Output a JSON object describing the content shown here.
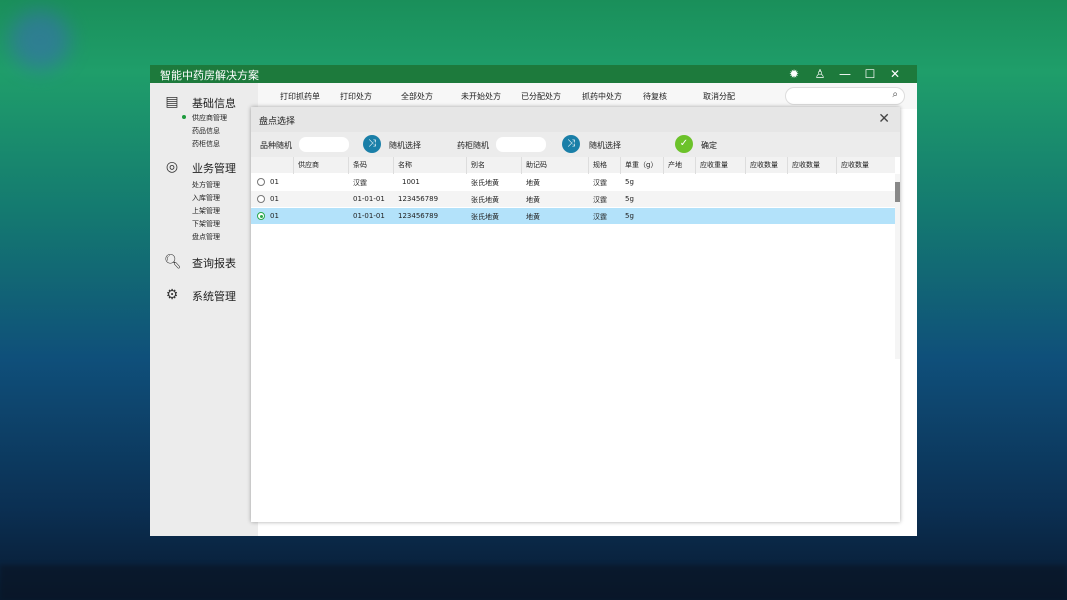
{
  "app": {
    "title": "智能中药房解决方案"
  },
  "titlebar_icons": [
    "settings-icon",
    "user-icon",
    "minimize-icon",
    "maximize-icon",
    "close-icon"
  ],
  "sidebar": {
    "sections": [
      {
        "label": "基础信息",
        "icon": "document-icon",
        "items": [
          "供应商管理",
          "药品信息",
          "药柜信息"
        ],
        "active_item": 0
      },
      {
        "label": "业务管理",
        "icon": "target-icon",
        "items": [
          "处方管理",
          "入库管理",
          "上架管理",
          "下架管理",
          "盘点管理"
        ]
      },
      {
        "label": "查询报表",
        "icon": "search-icon",
        "items": []
      },
      {
        "label": "系统管理",
        "icon": "gear-icon",
        "items": []
      }
    ]
  },
  "toolbar": {
    "buttons": [
      "打印抓药单",
      "打印处方",
      "全部处方",
      "未开始处方",
      "已分配处方",
      "抓药中处方",
      "待复核",
      "取消分配"
    ],
    "search_placeholder": ""
  },
  "dialog": {
    "title": "盘点选择",
    "variety_random_label": "品种随机",
    "variety_value": "",
    "random_select_label": "随机选择",
    "cabinet_random_label": "药柜随机",
    "cabinet_value": "",
    "random_select_label2": "随机选择",
    "confirm_label": "确定",
    "columns": [
      "",
      "供应商",
      "条码",
      "名称",
      "别名",
      "助记码",
      "规格",
      "单重（g）",
      "产地",
      "应收重量",
      "应收数量",
      "应收数量",
      "应收数量"
    ],
    "rows": [
      {
        "selected": false,
        "cells": [
          "01",
          "汉霆",
          "1001",
          "张氏地黄",
          "地黄",
          "汉霆",
          "5g",
          "",
          "",
          "",
          "",
          "",
          ""
        ]
      },
      {
        "selected": false,
        "cells": [
          "01",
          "01-01-01",
          "123456789",
          "张氏地黄",
          "地黄",
          "汉霆",
          "5g",
          "",
          "",
          "",
          "",
          "",
          ""
        ]
      },
      {
        "selected": true,
        "cells": [
          "01",
          "01-01-01",
          "123456789",
          "张氏地黄",
          "地黄",
          "汉霆",
          "5g",
          "",
          "",
          "",
          "",
          "",
          ""
        ]
      }
    ]
  },
  "colors": {
    "titlebar": "#1d7a3c",
    "accent_blue": "#1a7fa8",
    "confirm_green": "#6cc22a",
    "selected_row": "#b3e2fa"
  }
}
